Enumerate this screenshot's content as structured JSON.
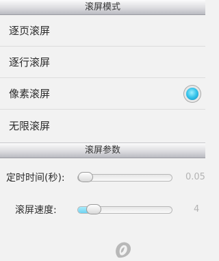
{
  "scroll_mode": {
    "title": "滚屏模式",
    "options": [
      {
        "label": "逐页滚屏",
        "selected": false
      },
      {
        "label": "逐行滚屏",
        "selected": false
      },
      {
        "label": "像素滚屏",
        "selected": true
      },
      {
        "label": "无限滚屏",
        "selected": false
      }
    ]
  },
  "scroll_params": {
    "title": "滚屏参数",
    "timer": {
      "label": "定时时间(秒):",
      "value": "0.05",
      "level": 0.0
    },
    "speed": {
      "label": "滚屏速度:",
      "value": "4",
      "level": 0.1
    }
  },
  "colors": {
    "accent": "#3cc6ec"
  },
  "icons": {
    "logo": "app-logo-icon"
  }
}
